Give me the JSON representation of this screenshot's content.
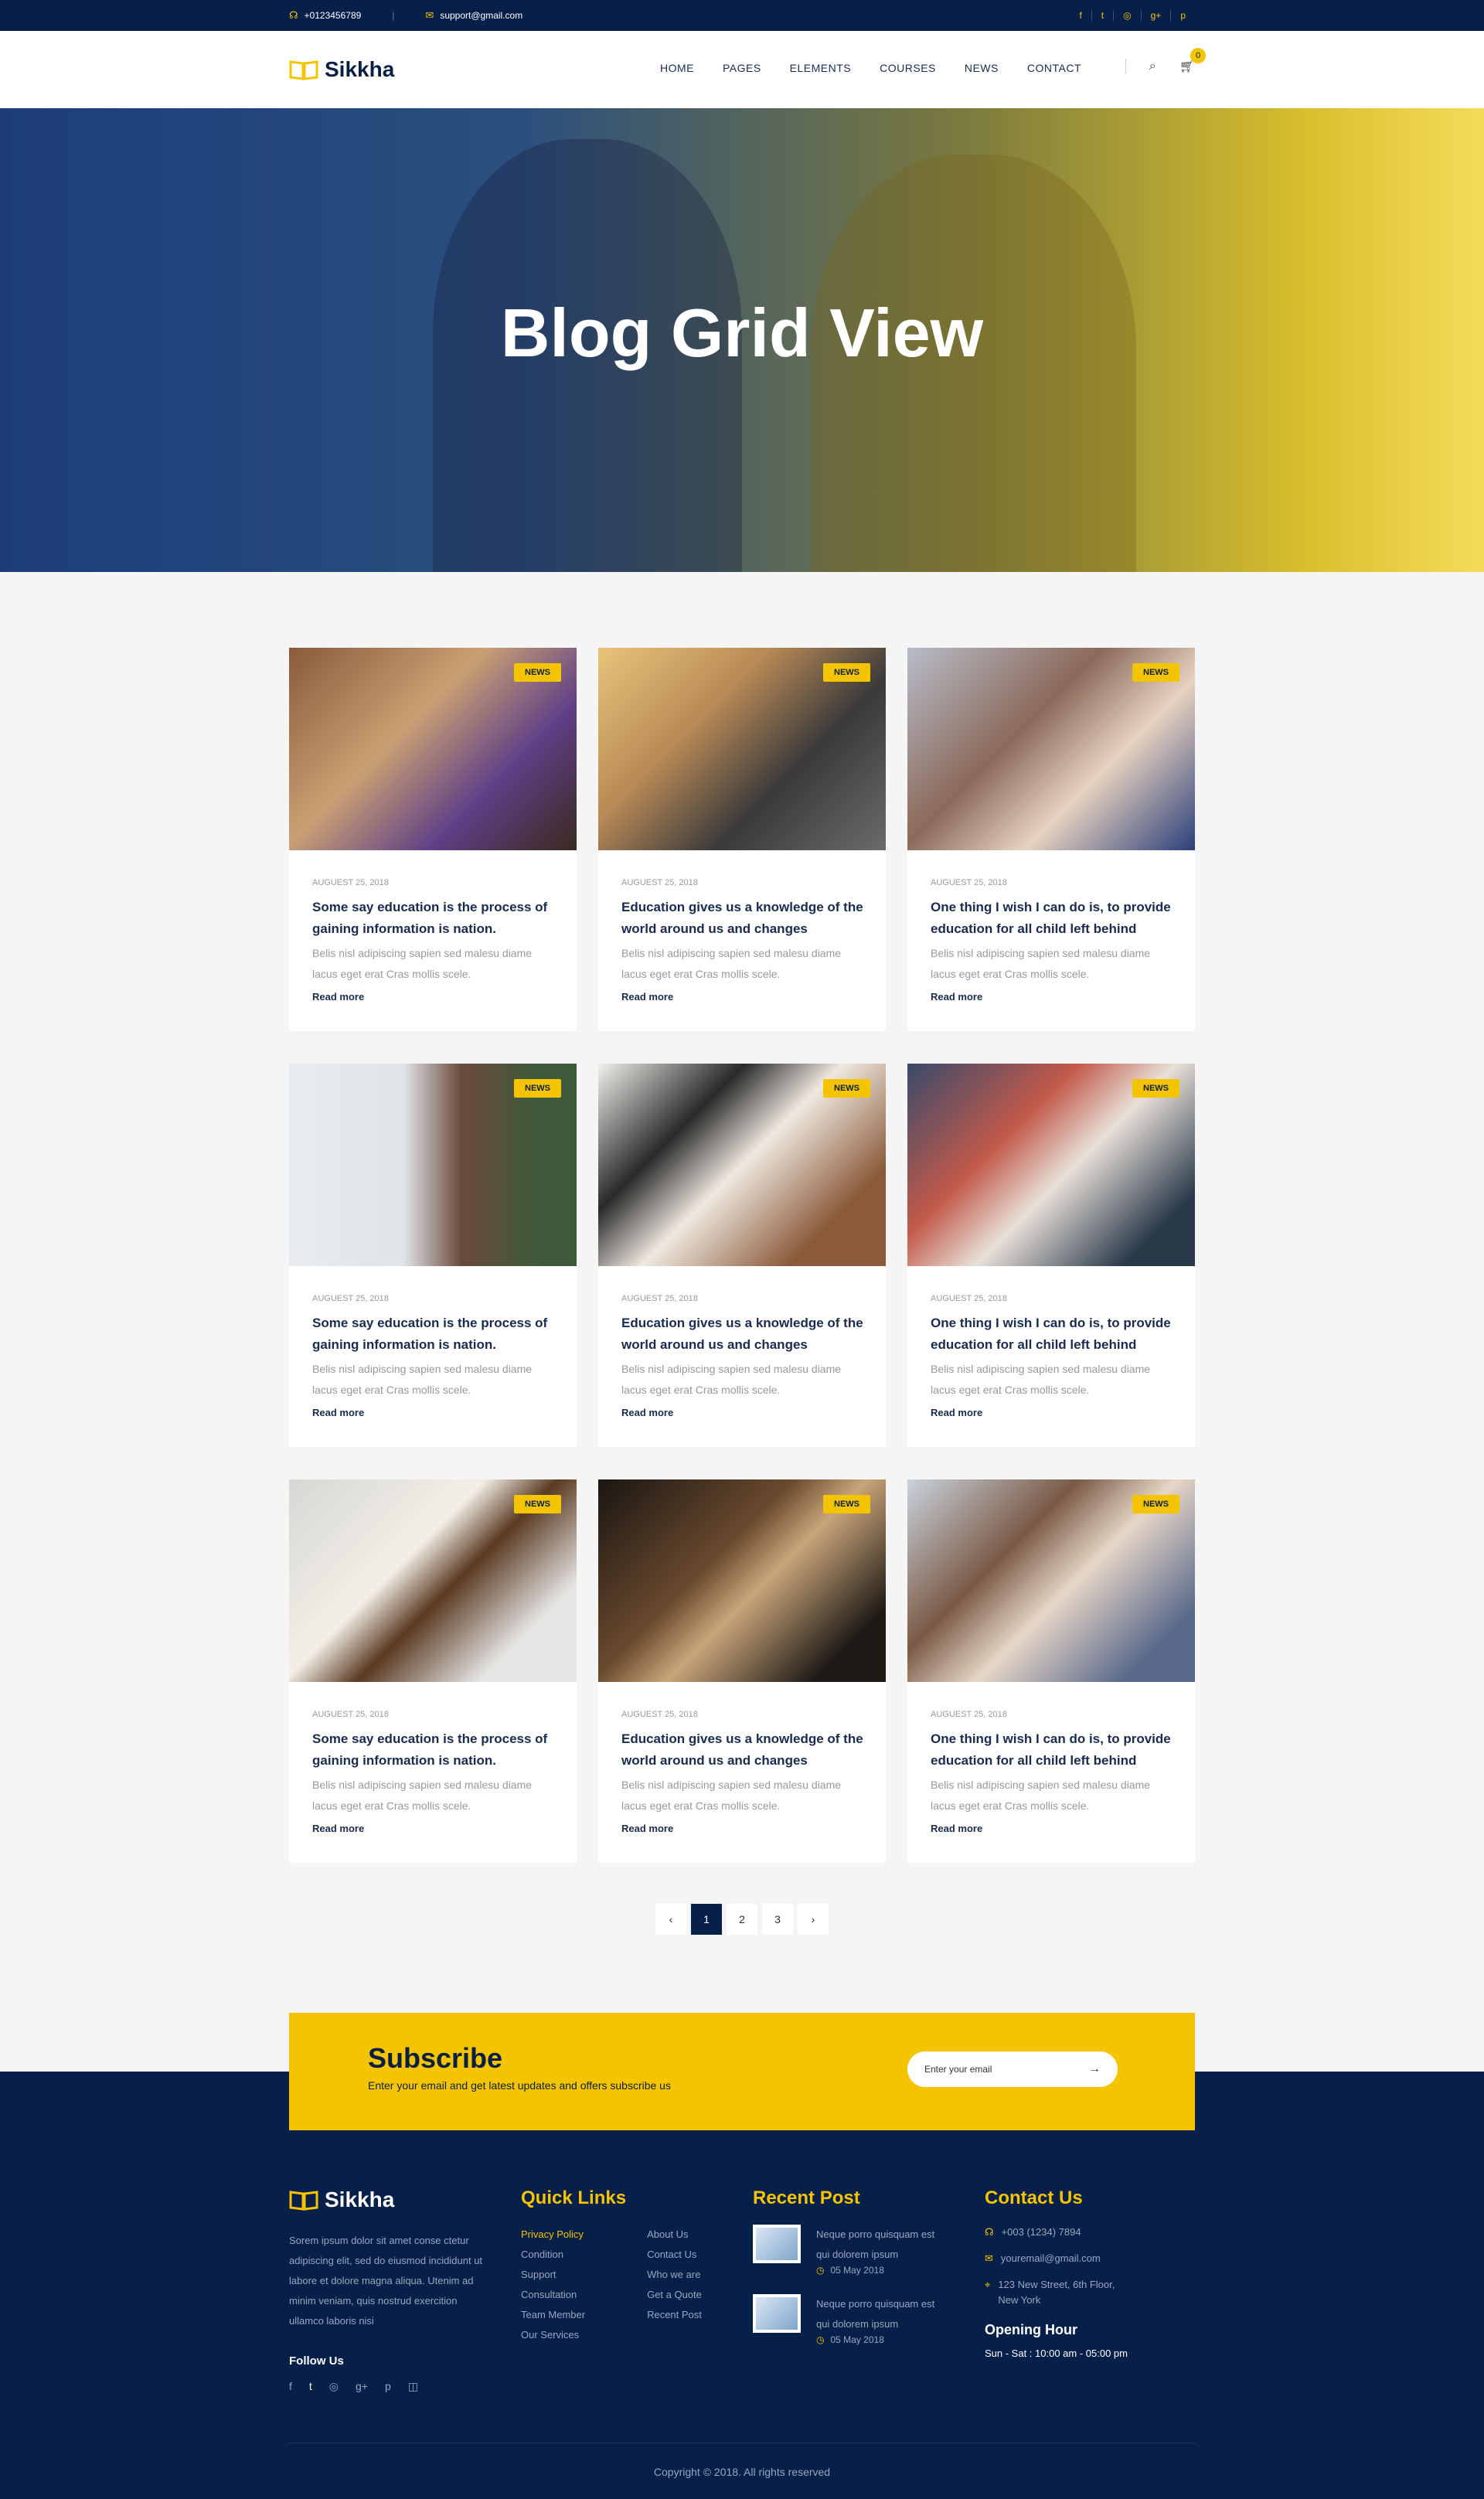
{
  "topbar": {
    "phone": "+0123456789",
    "email": "support@gmail.com",
    "social_icons": [
      "facebook-icon",
      "twitter-icon",
      "dribbble-icon",
      "google-plus-icon",
      "pinterest-icon"
    ],
    "social_glyphs": [
      "f",
      "t",
      "◎",
      "g+",
      "p"
    ]
  },
  "nav": {
    "brand": "Sikkha",
    "items": [
      "HOME",
      "PAGES",
      "ELEMENTS",
      "COURSES",
      "NEWS",
      "CONTACT"
    ],
    "cart_count": "0"
  },
  "hero": {
    "title": "Blog Grid View"
  },
  "posts": [
    {
      "tag": "NEWS",
      "date": "AUGUEST 25, 2018",
      "title": "Some say education is the process of gaining information is nation.",
      "desc": "Belis nisl adipiscing sapien sed malesu diame lacus eget erat Cras mollis scele.",
      "more": "Read more"
    },
    {
      "tag": "NEWS",
      "date": "AUGUEST 25, 2018",
      "title": "Education gives us a knowledge of the world around us and changes",
      "desc": "Belis nisl adipiscing sapien sed malesu diame lacus eget erat Cras mollis scele.",
      "more": "Read more"
    },
    {
      "tag": "NEWS",
      "date": "AUGUEST 25, 2018",
      "title": "One thing I wish I can do is, to provide education for all child left behind",
      "desc": "Belis nisl adipiscing sapien sed malesu diame lacus eget erat Cras mollis scele.",
      "more": "Read more"
    },
    {
      "tag": "NEWS",
      "date": "AUGUEST 25, 2018",
      "title": "Some say education is the process of gaining information is nation.",
      "desc": "Belis nisl adipiscing sapien sed malesu diame lacus eget erat Cras mollis scele.",
      "more": "Read more"
    },
    {
      "tag": "NEWS",
      "date": "AUGUEST 25, 2018",
      "title": "Education gives us a knowledge of the world around us and changes",
      "desc": "Belis nisl adipiscing sapien sed malesu diame lacus eget erat Cras mollis scele.",
      "more": "Read more"
    },
    {
      "tag": "NEWS",
      "date": "AUGUEST 25, 2018",
      "title": "One thing I wish I can do is, to provide education for all child left behind",
      "desc": "Belis nisl adipiscing sapien sed malesu diame lacus eget erat Cras mollis scele.",
      "more": "Read more"
    },
    {
      "tag": "NEWS",
      "date": "AUGUEST 25, 2018",
      "title": "Some say education is the process of gaining information is nation.",
      "desc": "Belis nisl adipiscing sapien sed malesu diame lacus eget erat Cras mollis scele.",
      "more": "Read more"
    },
    {
      "tag": "NEWS",
      "date": "AUGUEST 25, 2018",
      "title": "Education gives us a knowledge of the world around us and changes",
      "desc": "Belis nisl adipiscing sapien sed malesu diame lacus eget erat Cras mollis scele.",
      "more": "Read more"
    },
    {
      "tag": "NEWS",
      "date": "AUGUEST 25, 2018",
      "title": "One thing I wish I can do is, to provide education for all child left behind",
      "desc": "Belis nisl adipiscing sapien sed malesu diame lacus eget erat Cras mollis scele.",
      "more": "Read more"
    }
  ],
  "pagination": {
    "prev": "‹",
    "pages": [
      "1",
      "2",
      "3"
    ],
    "next": "›",
    "active": "1"
  },
  "subscribe": {
    "title": "Subscribe",
    "text": "Enter  your email and get latest updates and offers subscribe us",
    "placeholder": "Enter your email",
    "arrow": "→"
  },
  "footer": {
    "brand": "Sikkha",
    "about": "Sorem ipsum dolor sit amet conse ctetur adipiscing elit, sed do eiusmod  incididunt ut labore et dolore magna aliqua. Utenim ad minim veniam, quis nostrud exercition ullamco laboris nisi",
    "follow": "Follow Us",
    "follow_icons": [
      "facebook-icon",
      "twitter-icon",
      "dribbble-icon",
      "google-plus-icon",
      "pinterest-icon",
      "instagram-icon"
    ],
    "follow_glyphs": [
      "f",
      "t",
      "◎",
      "g+",
      "p",
      "◫"
    ],
    "quick_links_title": "Quick Links",
    "links_col1": [
      "Privacy Policy",
      "Condition",
      "Support",
      "Consultation",
      "Team Member",
      "Our Services"
    ],
    "links_col2": [
      "About Us",
      "Contact Us",
      "Who we are",
      "Get a Quote",
      "Recent Post"
    ],
    "recent_title": "Recent Post",
    "recent": [
      {
        "text": "Neque porro quisquam est qui dolorem ipsum",
        "date": "05 May 2018"
      },
      {
        "text": "Neque porro quisquam est qui dolorem ipsum",
        "date": "05 May 2018"
      }
    ],
    "contact_title": "Contact Us",
    "phone": "+003 (1234) 7894",
    "email": "youremail@gmail.com",
    "address": "123 New Street, 6th Floor, New York",
    "opening_title": "Opening Hour",
    "opening_text": "Sun - Sat : 10:00 am - 05:00 pm",
    "copyright": "Copyright © 2018. All rights reserved"
  },
  "colors": {
    "navy": "#07204a",
    "yellow": "#f5c400"
  }
}
